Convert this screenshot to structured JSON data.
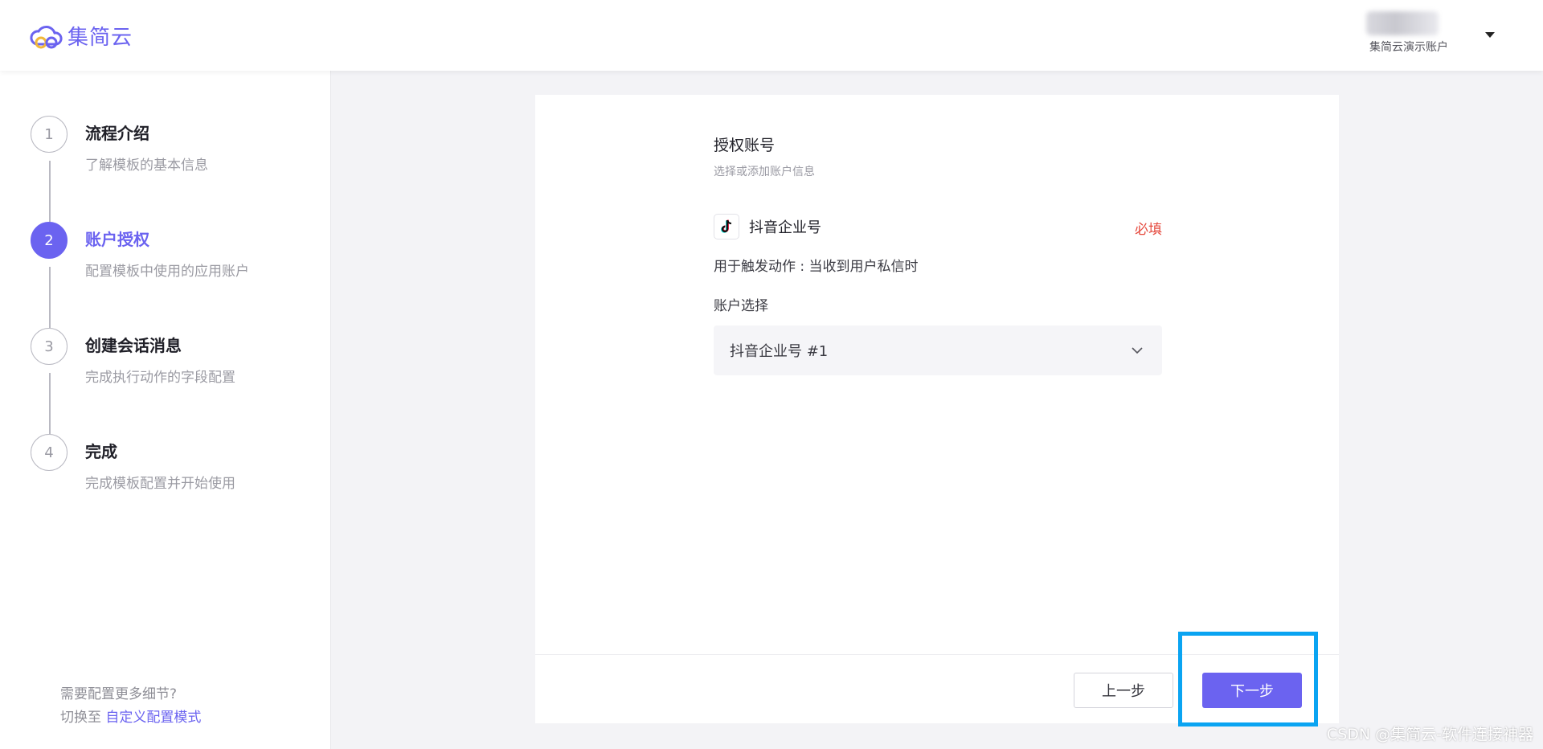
{
  "brand": {
    "name": "集简云",
    "color": "#6b63f0"
  },
  "header": {
    "account_name": "集简云演示账户"
  },
  "steps": [
    {
      "number": "1",
      "title": "流程介绍",
      "desc": "了解模板的基本信息",
      "active": false
    },
    {
      "number": "2",
      "title": "账户授权",
      "desc": "配置模板中使用的应用账户",
      "active": true
    },
    {
      "number": "3",
      "title": "创建会话消息",
      "desc": "完成执行动作的字段配置",
      "active": false
    },
    {
      "number": "4",
      "title": "完成",
      "desc": "完成模板配置并开始使用",
      "active": false
    }
  ],
  "sidebar_footer": {
    "line1": "需要配置更多细节?",
    "prefix": "切换至",
    "link": "自定义配置模式"
  },
  "form": {
    "title": "授权账号",
    "subtitle": "选择或添加账户信息",
    "app_icon": "tiktok-icon",
    "app_name": "抖音企业号",
    "required": "必填",
    "trigger": "用于触发动作 : 当收到用户私信时",
    "field_label": "账户选择",
    "selected_account": "抖音企业号 #1"
  },
  "footer": {
    "prev_label": "上一步",
    "next_label": "下一步"
  },
  "colors": {
    "accent": "#6b63f0",
    "required": "#e5483c",
    "highlight": "#0aa4f2"
  },
  "watermark": "CSDN @集简云-软件连接神器"
}
